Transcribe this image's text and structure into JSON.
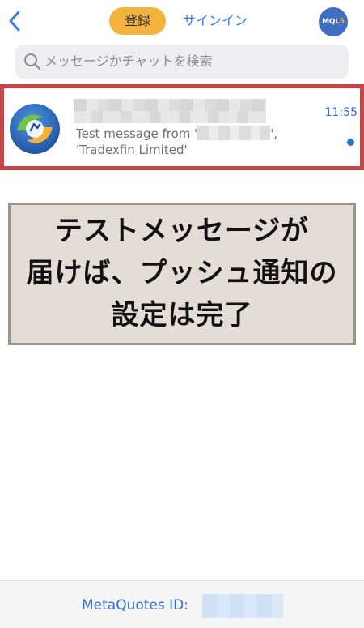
{
  "header": {
    "register_label": "登録",
    "signin_label": "サインイン",
    "profile_badge_text": "MQL",
    "profile_badge_digit": "5"
  },
  "search": {
    "placeholder": "メッセージかチャットを検索"
  },
  "chat": {
    "time": "11:55",
    "preview_line1_prefix": "Test message from '",
    "preview_line1_suffix": "',",
    "preview_line2": "'Tradexfin Limited'",
    "unread": true
  },
  "caption": {
    "line1": "テストメッセージが",
    "line2": "届けば、プッシュ通知の",
    "line3": "設定は完了"
  },
  "footer": {
    "metaquotes_label": "MetaQuotes ID:"
  },
  "colors": {
    "accent": "#2f6fce",
    "register_pill": "#f3b33d",
    "highlight_border": "#c74545",
    "caption_bg": "#e3ddd6"
  }
}
